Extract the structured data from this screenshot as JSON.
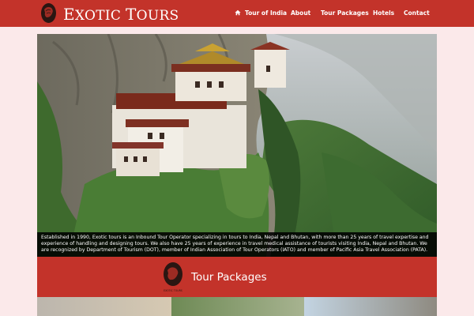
{
  "header": {
    "brand_initial_1": "E",
    "brand_rest_1": "XOTIC",
    "brand_initial_2": "T",
    "brand_rest_2": "OURS",
    "logo_icon": "rhino-logo-icon",
    "bg_color": "#c3332a"
  },
  "nav": {
    "items": [
      {
        "label": "Tour of India",
        "icon": "home-icon"
      },
      {
        "label": "About"
      },
      {
        "label": "Tour Packages"
      },
      {
        "label": "Hotels"
      },
      {
        "label": "Contact"
      }
    ]
  },
  "hero": {
    "caption": "Established in 1990, Exotic tours is an Inbound Tour Operator specializing in tours to India, Nepal and Bhutan, with more than 25 years of travel expertise and experience of handling and designing tours. We also have 25 years of experience in travel medical assistance of tourists visiting India, Nepal and Bhutan. We are recognized by Department of Tourism (DOT), member of Indian Association of Tour Operators (IATO) and member of Pacific Asia Travel Association (PATA)."
  },
  "packages": {
    "title": "Tour Packages",
    "logo_text": "EXOTIC TOURS"
  }
}
